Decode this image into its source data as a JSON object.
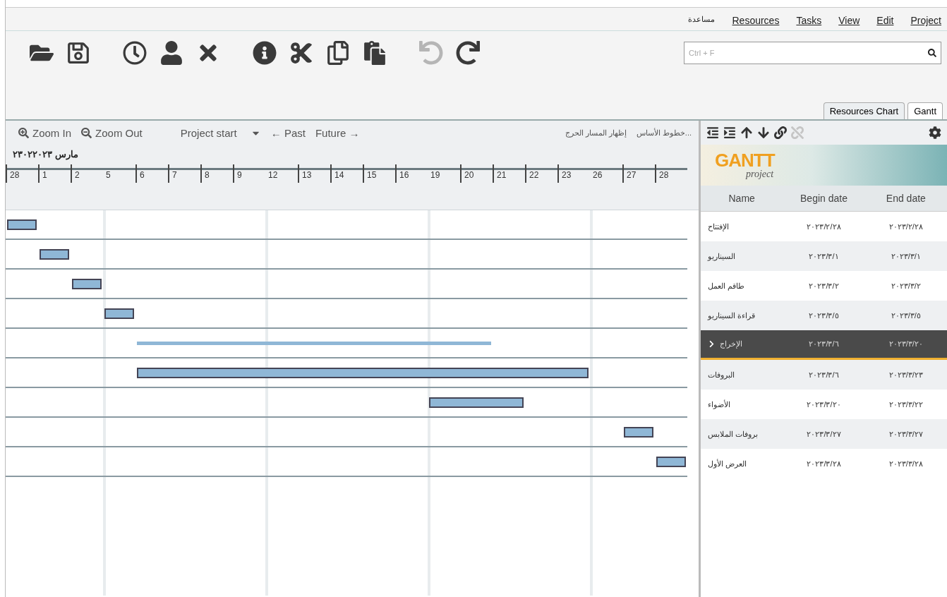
{
  "menu": [
    {
      "label": "Project"
    },
    {
      "label": "Edit"
    },
    {
      "label": "View"
    },
    {
      "label": "Tasks"
    },
    {
      "label": "Resources"
    },
    {
      "label": "مساعدة"
    }
  ],
  "toolbar": [
    {
      "disabled": false
    },
    {
      "disabled": false
    },
    {
      "disabled": false
    },
    {
      "disabled": false
    },
    {
      "disabled": false
    },
    {
      "disabled": false
    },
    {
      "disabled": false
    },
    {
      "disabled": false
    },
    {
      "disabled": false
    },
    {
      "disabled": true
    },
    {
      "disabled": false
    }
  ],
  "search": {
    "placeholder": "Ctrl + F"
  },
  "tabs": [
    {
      "label": "Gantt",
      "selected": true
    },
    {
      "label": "Resources Chart",
      "selected": false
    }
  ],
  "chart_toolbar": {
    "zoom_in": "Zoom In",
    "zoom_out": "Zoom Out",
    "project_start": "Project start",
    "past": "← Past",
    "future": "Future →",
    "baselines": "خطوط الأساس...",
    "critical_path": "إظهار المسار الحرج"
  },
  "timeline": {
    "month": "مارس ٢٣٠٢٢٠٢٣",
    "ticks": [
      {
        "label": "28",
        "after_weekend": false
      },
      {
        "label": "27",
        "after_weekend": false
      },
      {
        "label": "26",
        "after_weekend": true
      },
      {
        "label": "23",
        "after_weekend": false
      },
      {
        "label": "22",
        "after_weekend": false
      },
      {
        "label": "21",
        "after_weekend": false
      },
      {
        "label": "20",
        "after_weekend": false
      },
      {
        "label": "19",
        "after_weekend": true
      },
      {
        "label": "16",
        "after_weekend": false
      },
      {
        "label": "15",
        "after_weekend": false
      },
      {
        "label": "14",
        "after_weekend": false
      },
      {
        "label": "13",
        "after_weekend": false
      },
      {
        "label": "12",
        "after_weekend": true
      },
      {
        "label": "9",
        "after_weekend": false
      },
      {
        "label": "8",
        "after_weekend": false
      },
      {
        "label": "7",
        "after_weekend": false
      },
      {
        "label": "6",
        "after_weekend": false
      },
      {
        "label": "5",
        "after_weekend": true
      },
      {
        "label": "2",
        "after_weekend": false
      },
      {
        "label": "1",
        "after_weekend": false
      },
      {
        "label": "28",
        "after_weekend": false
      }
    ]
  },
  "tree_toolbar": [
    {
      "disabled": false
    },
    {
      "disabled": false
    },
    {
      "disabled": false
    },
    {
      "disabled": false
    },
    {
      "disabled": false
    },
    {
      "disabled": true
    }
  ],
  "logo": {
    "title": "GANTT",
    "subtitle": "project"
  },
  "table": {
    "columns": [
      "End date",
      "Begin date",
      "Name"
    ],
    "rows": [
      {
        "name": "الإفتتاح",
        "begin": "٢٠٢٣/٢/٢٨",
        "end": "٢٠٢٣/٢/٢٨",
        "kind": "task",
        "selected": false
      },
      {
        "name": "السيناريو",
        "begin": "٢٠٢٣/٣/١",
        "end": "٢٠٢٣/٣/١",
        "kind": "task",
        "selected": false
      },
      {
        "name": "طاقم العمل",
        "begin": "٢٠٢٣/٣/٢",
        "end": "٢٠٢٣/٣/٢",
        "kind": "task",
        "selected": false
      },
      {
        "name": "قراءة السيناريو",
        "begin": "٢٠٢٣/٣/٥",
        "end": "٢٠٢٣/٣/٥",
        "kind": "task",
        "selected": false
      },
      {
        "name": "الإخراج",
        "begin": "٢٠٢٣/٣/٦",
        "end": "٢٠٢٣/٣/٢٠",
        "kind": "summary",
        "selected": true
      },
      {
        "name": "البروفات",
        "begin": "٢٠٢٣/٣/٦",
        "end": "٢٠٢٣/٣/٢٣",
        "kind": "task",
        "selected": false
      },
      {
        "name": "الأضواء",
        "begin": "٢٠٢٣/٣/٢٠",
        "end": "٢٠٢٣/٣/٢٢",
        "kind": "task",
        "selected": false
      },
      {
        "name": "بروفات الملابس",
        "begin": "٢٠٢٣/٣/٢٧",
        "end": "٢٠٢٣/٣/٢٧",
        "kind": "task",
        "selected": false
      },
      {
        "name": "العرض الأول",
        "begin": "٢٠٢٣/٣/٢٨",
        "end": "٢٠٢٣/٣/٢٨",
        "kind": "task",
        "selected": false
      }
    ]
  }
}
